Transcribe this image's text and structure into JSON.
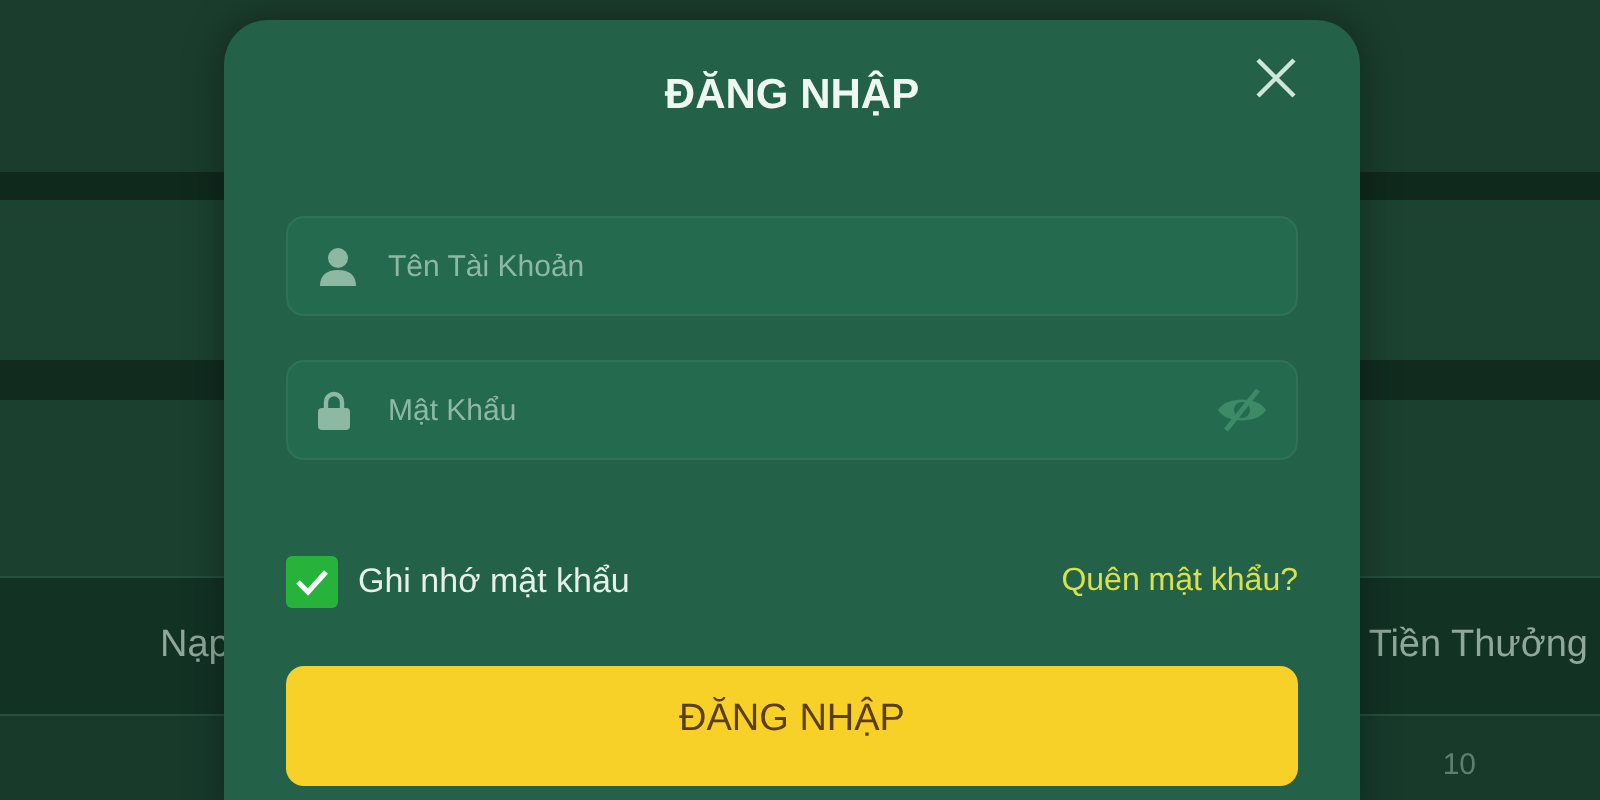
{
  "background_table": {
    "columns": [
      {
        "label": "Nạp"
      },
      {
        "label": "Tiền Thưởng"
      }
    ],
    "cells": [
      "10"
    ]
  },
  "login_dialog": {
    "title": "ĐĂNG NHẬP",
    "fields": [
      {
        "kind": "user",
        "placeholder": "Tên Tài Khoản"
      },
      {
        "kind": "password",
        "placeholder": "Mật Khẩu"
      }
    ],
    "remember": {
      "label": "Ghi nhớ mật khẩu",
      "checked": true
    },
    "forgot_link": "Quên mật khẩu?",
    "submit": "ĐĂNG NHẬP"
  }
}
